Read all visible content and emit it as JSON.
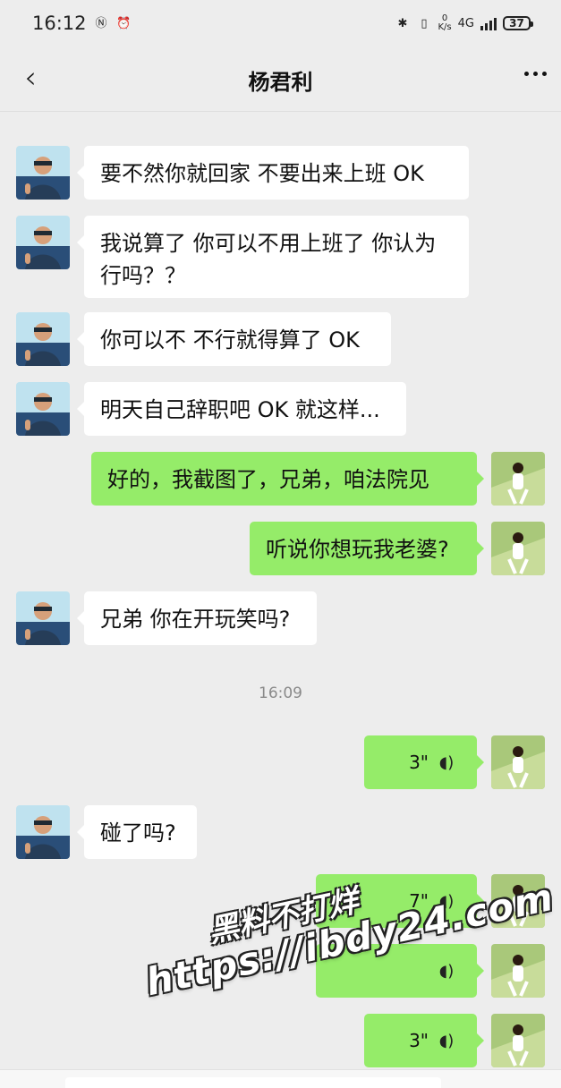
{
  "status": {
    "time": "16:12",
    "speed_top": "0",
    "speed_bottom": "K/s",
    "network": "4G",
    "battery": "37",
    "icons": [
      "nfc-icon",
      "alarm-icon",
      "bluetooth-icon",
      "vibrate-icon",
      "signal-icon",
      "battery-icon"
    ]
  },
  "header": {
    "title": "杨君利",
    "back_icon": "back-icon",
    "more_icon": "more-icon"
  },
  "messages": [
    {
      "side": "in",
      "type": "text",
      "text": "要不然你就回家 不要出来上班 OK"
    },
    {
      "side": "in",
      "type": "text",
      "text": "我说算了 你可以不用上班了 你认为行吗？？"
    },
    {
      "side": "in",
      "type": "text",
      "text": "你可以不 不行就得算了 OK"
    },
    {
      "side": "in",
      "type": "text",
      "text": "明天自己辞职吧 OK 就这样..."
    },
    {
      "side": "out",
      "type": "text",
      "text": "好的，我截图了，兄弟，咱法院见"
    },
    {
      "side": "out",
      "type": "text",
      "text": "听说你想玩我老婆?"
    },
    {
      "side": "in",
      "type": "text",
      "text": "兄弟 你在开玩笑吗?"
    },
    {
      "side": "time",
      "type": "time",
      "text": "16:09"
    },
    {
      "side": "out",
      "type": "voice",
      "text": "3\""
    },
    {
      "side": "in",
      "type": "text",
      "text": "碰了吗?"
    },
    {
      "side": "out",
      "type": "voice",
      "text": "7\""
    },
    {
      "side": "out",
      "type": "voice",
      "text": ""
    },
    {
      "side": "out",
      "type": "voice",
      "text": "3\""
    }
  ],
  "watermark": {
    "line1": "黑料不打烊",
    "line2": "https://ibdy24.com"
  }
}
